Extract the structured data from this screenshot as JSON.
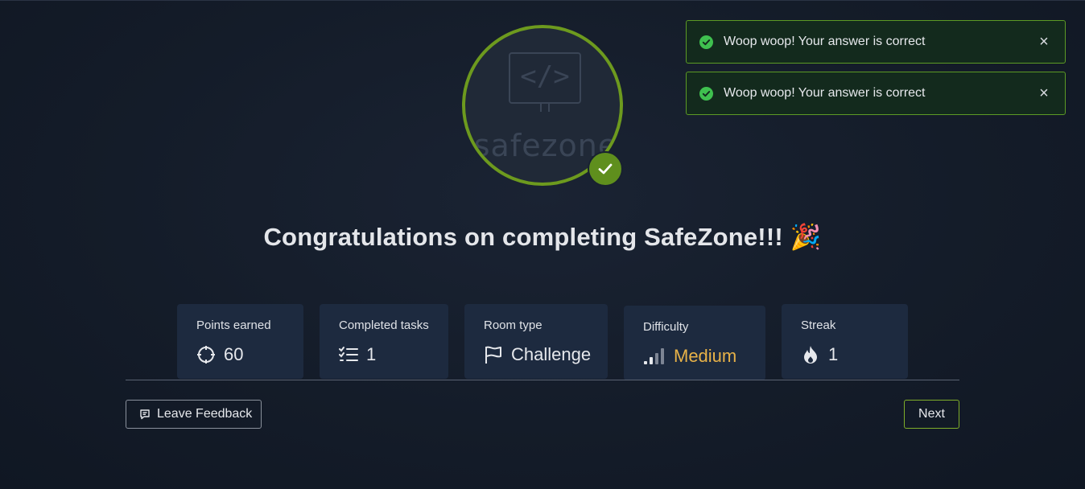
{
  "room": {
    "logo_text": "safezone",
    "logo_code": "</>",
    "completed": true
  },
  "toasts": [
    {
      "message": "Woop woop! Your answer is correct",
      "close_label": "×"
    },
    {
      "message": "Woop woop! Your answer is correct",
      "close_label": "×"
    }
  ],
  "title": {
    "text": "Congratulations on completing SafeZone!!!",
    "emoji": "🎉"
  },
  "stats": {
    "points": {
      "label": "Points earned",
      "value": "60",
      "icon": "crosshair-icon"
    },
    "tasks": {
      "label": "Completed tasks",
      "value": "1",
      "icon": "checklist-icon"
    },
    "room_type": {
      "label": "Room type",
      "value": "Challenge",
      "icon": "flag-icon"
    },
    "difficulty": {
      "label": "Difficulty",
      "value": "Medium",
      "icon": "signal-bars-icon"
    },
    "streak": {
      "label": "Streak",
      "value": "1",
      "icon": "fire-icon"
    }
  },
  "actions": {
    "feedback_label": "Leave Feedback",
    "next_label": "Next"
  },
  "colors": {
    "accent_green": "#6d9a1e",
    "toast_border": "#5c9a24",
    "medium": "#e8b248",
    "card_bg": "#1d2a3f"
  }
}
